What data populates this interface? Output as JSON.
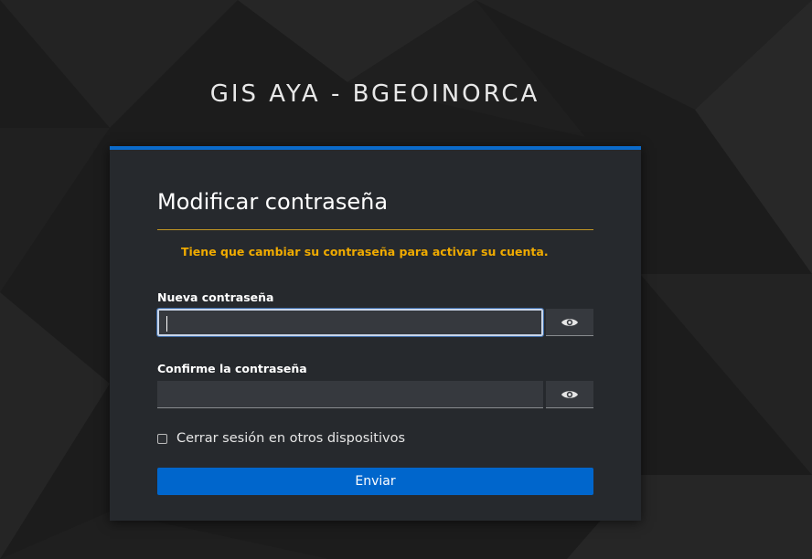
{
  "realm": {
    "title": "GIS AYA - BGEOINORCA"
  },
  "form": {
    "title": "Modificar contraseña",
    "alert": "Tiene que cambiar su contraseña para activar su cuenta.",
    "new_password": {
      "label": "Nueva contraseña",
      "value": "",
      "toggle_icon": "eye-icon"
    },
    "confirm_password": {
      "label": "Confirme la contraseña",
      "value": "",
      "toggle_icon": "eye-icon"
    },
    "logout_other_sessions": {
      "label": "Cerrar sesión en otros dispositivos",
      "checked": false
    },
    "submit_label": "Enviar"
  },
  "colors": {
    "accent": "#0066cc",
    "alert": "#f0ab00",
    "card_bg": "#26292d",
    "page_bg": "#1b1b1b"
  }
}
